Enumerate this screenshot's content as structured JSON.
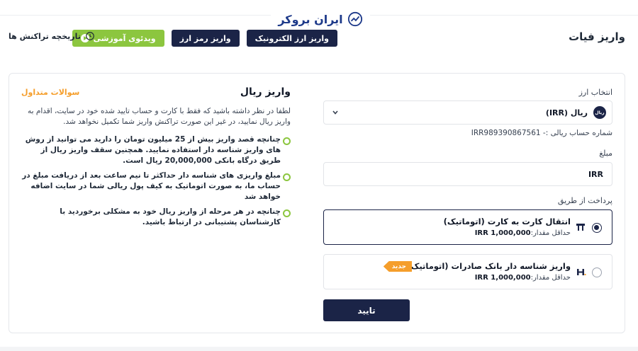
{
  "brand": {
    "name": "ایران بروکر",
    "color": "#1e3a8a"
  },
  "header": {
    "title": "واریز فیات",
    "tabs": [
      {
        "label": "واریز ارز الکترونیک"
      },
      {
        "label": "واریز رمز ارز"
      },
      {
        "label": "ویدئوی آموزشی"
      }
    ],
    "history_label": "تاریخچه تراکنش ها"
  },
  "form": {
    "currency_label": "انتخاب ارز",
    "currency_icon_text": "ریال",
    "currency_value": "ریال (IRR)",
    "account_line": "شماره حساب ریالی :- IRR989390867561",
    "amount_label": "مبلغ",
    "amount_value": "IRR",
    "method_label": "پرداخت از طریق",
    "methods": [
      {
        "title": "انتقال کارت به کارت (اتوماتیک)",
        "min_label": "حداقل مقدار:",
        "min_value": "IRR 1,000,000",
        "selected": true,
        "icon": "card-transfer-icon"
      },
      {
        "title": "واریز شناسه دار بانک صادرات (اتوماتیک)",
        "min_label": "حداقل مقدار:",
        "min_value": "IRR 1,000,000",
        "selected": false,
        "badge": "جدید",
        "icon": "bank-saderat-icon"
      }
    ],
    "confirm_label": "تایید"
  },
  "info": {
    "title": "واریز ریال",
    "faq_label": "سوالات متداول",
    "description": "لطفا در نظر داشته باشید که فقط با کارت و حساب تایید شده خود در سایت، اقدام به واریز ریال نمایید، در غیر این صورت تراکنش واریز شما تکمیل نخواهد شد.",
    "bullets": [
      "چنانچه قصد واریز بیش از 25 میلیون تومان را دارید می توانید از روش های واریز شناسه دار استفاده نمایید. همچنین سقف واریز ریال از طریق درگاه بانکی 20,000,000 ریال است.",
      "مبلغ واریزی های شناسه دار حداکثر تا نیم ساعت بعد از دریافت مبلغ در حساب ما، به صورت اتوماتیک به کیف پول ریالی شما در سایت اضافه خواهد شد",
      "چنانچه در هر مرحله از واریز ریال خود به مشکلی برخوردید با کارشناسان پشتیبانی در ارتباط باشید."
    ]
  },
  "colors": {
    "navy": "#1b2447",
    "green": "#8cc63f",
    "orange": "#f59e2b"
  }
}
